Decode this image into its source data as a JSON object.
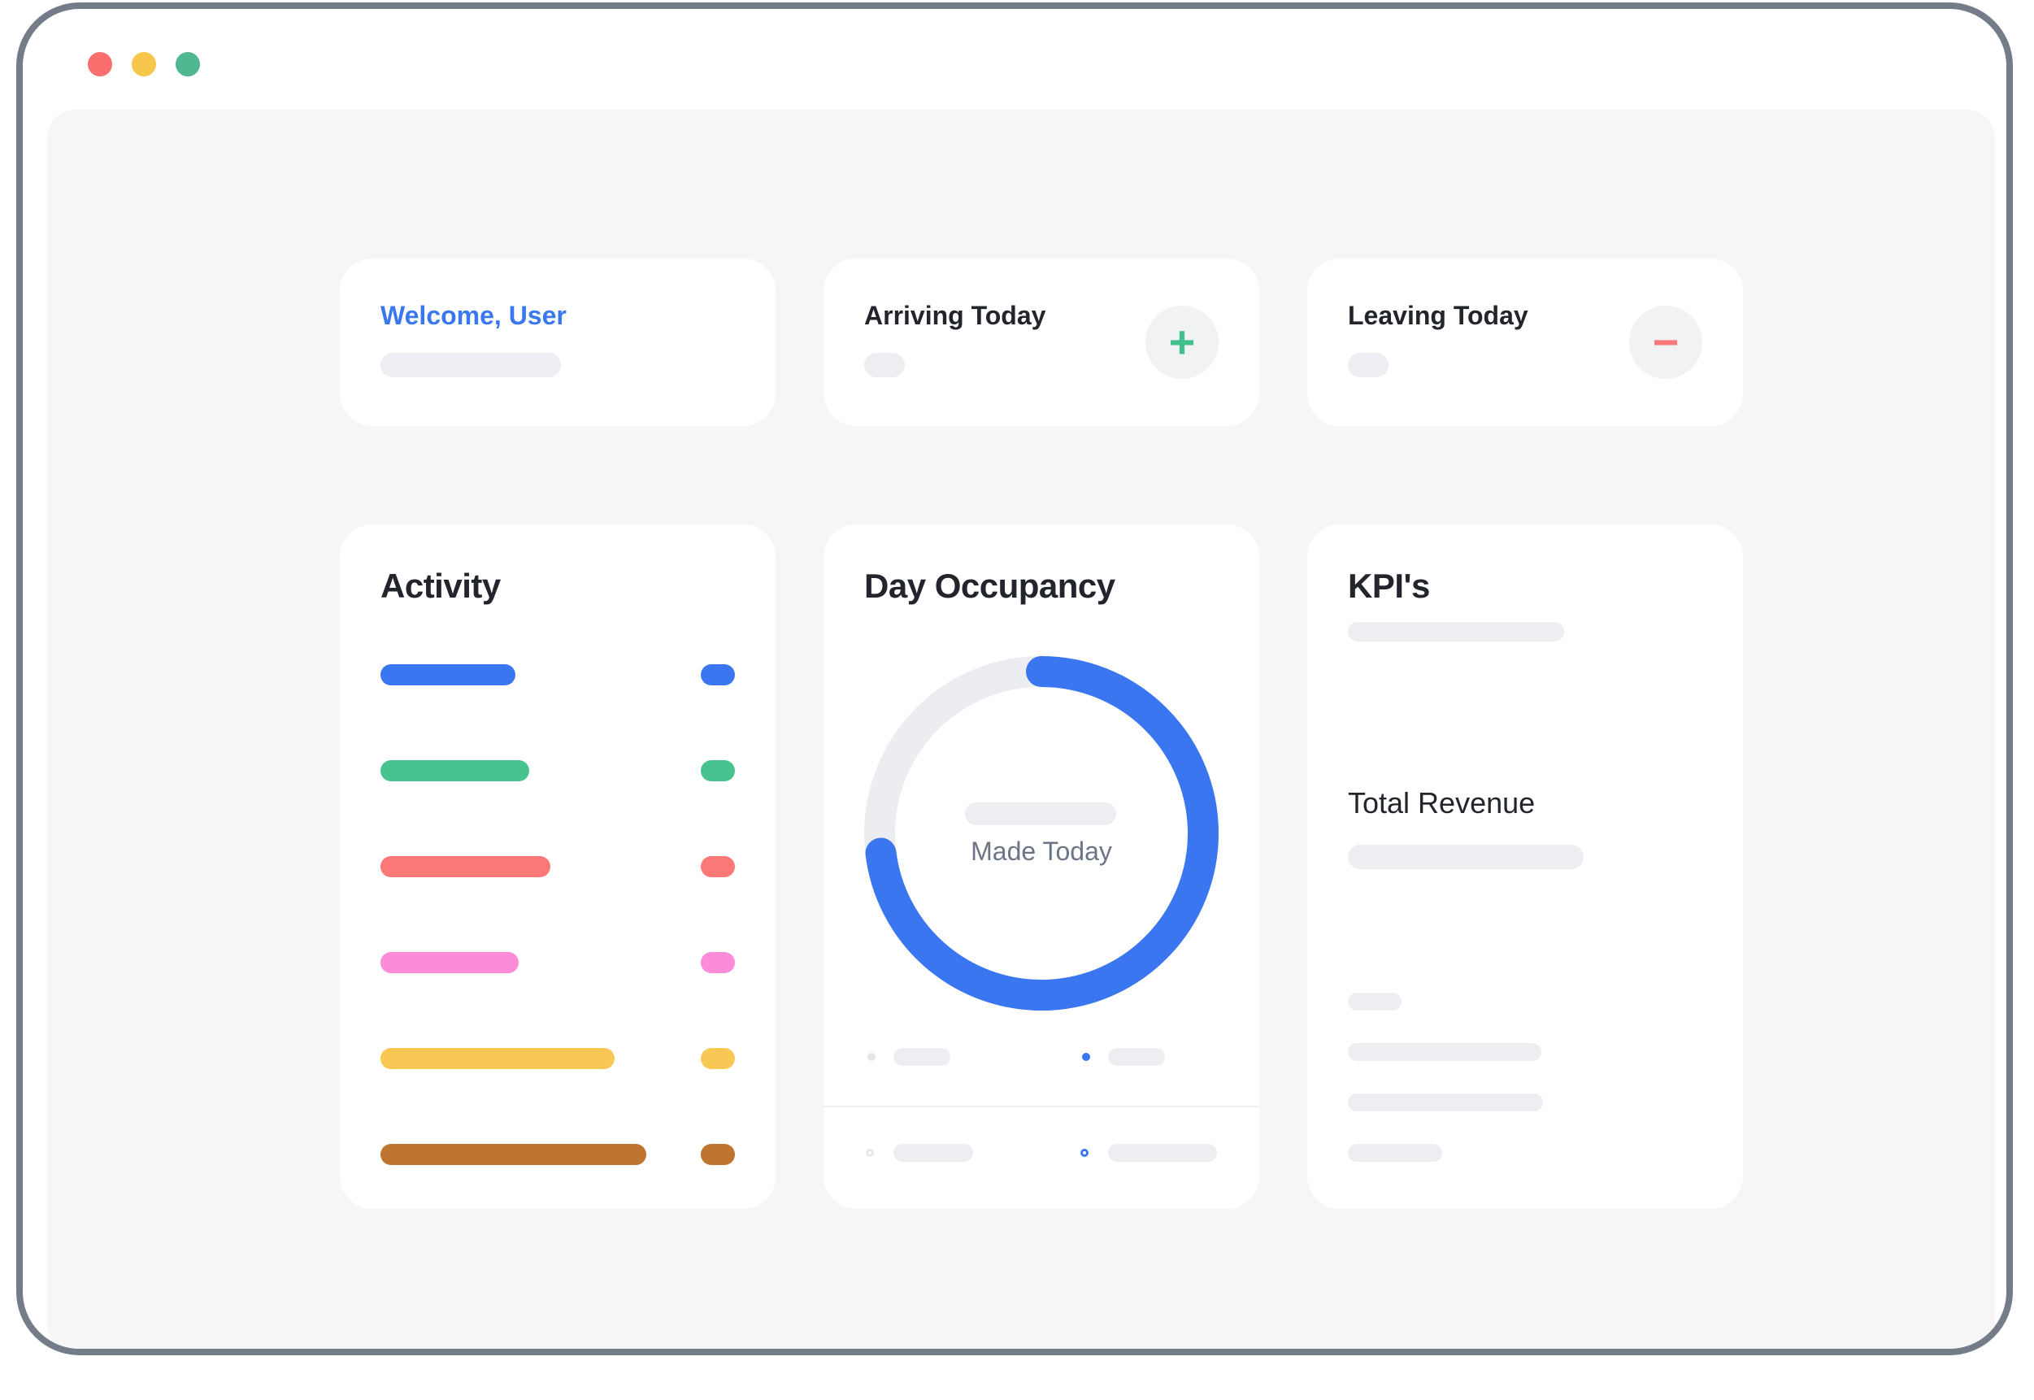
{
  "window": {
    "controls": [
      {
        "name": "close",
        "color": "#fa6e6e"
      },
      {
        "name": "minimize",
        "color": "#f7c74c"
      },
      {
        "name": "maximize",
        "color": "#4fb891"
      }
    ]
  },
  "cards": {
    "welcome": {
      "title": "Welcome, User",
      "title_color": "#3a78ef"
    },
    "arriving": {
      "title": "Arriving Today",
      "button_icon": "plus-icon",
      "button_symbol": "+",
      "accent": "#41c08e"
    },
    "leaving": {
      "title": "Leaving Today",
      "button_icon": "minus-icon",
      "button_symbol": "−",
      "accent": "#f77777"
    },
    "activity": {
      "title": "Activity",
      "rows": [
        {
          "color": "#3a76ef",
          "fill": 0.38
        },
        {
          "color": "#47c390",
          "fill": 0.42
        },
        {
          "color": "#fb7876",
          "fill": 0.48
        },
        {
          "color": "#fb8cd9",
          "fill": 0.39
        },
        {
          "color": "#f7c853",
          "fill": 0.66
        },
        {
          "color": "#bf7430",
          "fill": 0.75
        }
      ]
    },
    "occupancy": {
      "title": "Day Occupancy",
      "center_label": "Made Today",
      "progress": 0.73,
      "ring_color": "#3a76ef",
      "track_color": "#ebedf0"
    },
    "kpis": {
      "title": "KPI's",
      "total_revenue_label": "Total Revenue"
    }
  }
}
